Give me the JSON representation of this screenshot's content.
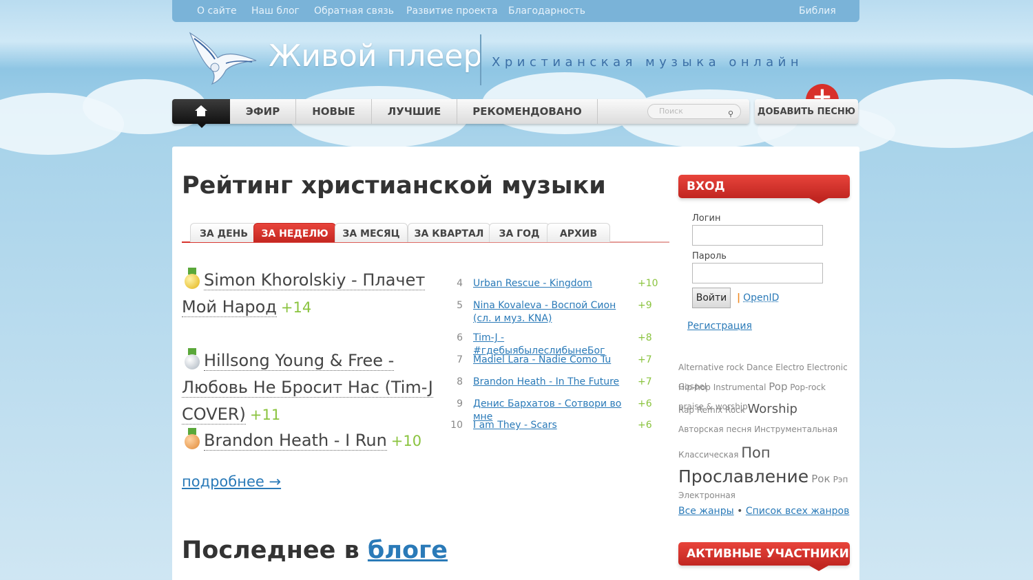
{
  "topbar": {
    "links": [
      "О сайте",
      "Наш блог",
      "Обратная связь",
      "Развитие проекта",
      "Благодарность"
    ],
    "right_link": "Библия"
  },
  "header": {
    "site_title": "Живой плеер",
    "tagline": "Христианская музыка онлайн"
  },
  "nav": {
    "items": [
      "ЭФИР",
      "НОВЫЕ",
      "ЛУЧШИЕ",
      "РЕКОМЕНДОВАНО"
    ],
    "search_placeholder": "Поиск",
    "add_song": "ДОБАВИТЬ ПЕСНЮ"
  },
  "main": {
    "title": "Рейтинг христианской музыки",
    "tabs": [
      "ЗА ДЕНЬ",
      "ЗА НЕДЕЛЮ",
      "ЗА МЕСЯЦ",
      "ЗА КВАРТАЛ",
      "ЗА ГОД",
      "АРХИВ"
    ],
    "active_tab": "ЗА НЕДЕЛЮ",
    "top3": [
      {
        "title": "Simon Khorolskiy - Плачет Мой Народ",
        "score": "+14",
        "medal": "gold"
      },
      {
        "title": "Hillsong Young & Free - Любовь Не Бросит Нас (Tim-J COVER)",
        "score": "+11",
        "medal": "silver"
      },
      {
        "title": "Brandon Heath - I Run",
        "score": "+10",
        "medal": "bronze"
      }
    ],
    "more_link": "подробнее →",
    "ranking": [
      {
        "num": "4",
        "title": "Urban Rescue - Kingdom",
        "score": "+10"
      },
      {
        "num": "5",
        "title": "Nina Kovaleva - Воспой Сион (сл. и муз. KNA)",
        "score": "+9"
      },
      {
        "num": "6",
        "title": "Tim-J - #гдебыябылеслибынеБог",
        "score": "+8"
      },
      {
        "num": "7",
        "title": "Madiel Lara - Nadie Como Tu",
        "score": "+7"
      },
      {
        "num": "8",
        "title": "Brandon Heath - In The Future",
        "score": "+7"
      },
      {
        "num": "9",
        "title": "Денис Бархатов - Сотвори во мне",
        "score": "+6"
      },
      {
        "num": "10",
        "title": "I am They - Scars",
        "score": "+6"
      }
    ],
    "blog_heading_prefix": "Последнее в",
    "blog_heading_link": "блоге"
  },
  "sidebar": {
    "login_heading": "ВХОД",
    "login_label": "Логин",
    "password_label": "Пароль",
    "login_button": "Войти",
    "openid": "OpenID",
    "register": "Регистрация",
    "tags": [
      {
        "text": "Alternative rock",
        "size": "s"
      },
      {
        "text": "Dance",
        "size": "s"
      },
      {
        "text": "Electro",
        "size": "s"
      },
      {
        "text": "Electronic",
        "size": "s"
      },
      {
        "text": "Gospel",
        "size": "s"
      },
      {
        "text": "Hip-hop",
        "size": "s"
      },
      {
        "text": "Instrumental",
        "size": "s"
      },
      {
        "text": "Pop",
        "size": "m"
      },
      {
        "text": "Pop-rock",
        "size": "s"
      },
      {
        "text": "praise & worship",
        "size": "s"
      },
      {
        "text": "Rap",
        "size": "s"
      },
      {
        "text": "Remix",
        "size": "s"
      },
      {
        "text": "Rock",
        "size": "s"
      },
      {
        "text": "Worship",
        "size": "l"
      },
      {
        "text": "Авторская песня",
        "size": "s"
      },
      {
        "text": "Инструментальная",
        "size": "s"
      },
      {
        "text": "Классическая",
        "size": "s"
      },
      {
        "text": "Поп",
        "size": "xl"
      },
      {
        "text": "Прославление",
        "size": "xxl"
      },
      {
        "text": "Рок",
        "size": "m"
      },
      {
        "text": "Рэп",
        "size": "s"
      },
      {
        "text": "Электронная",
        "size": "s"
      }
    ],
    "all_genres": "Все жанры",
    "genres_list": "Список всех жанров",
    "active_heading": "АКТИВНЫЕ УЧАСТНИКИ"
  },
  "colors": {
    "accent_red": "#d8312a",
    "link_blue": "#2a7ab8",
    "score_green": "#8ac33e"
  }
}
